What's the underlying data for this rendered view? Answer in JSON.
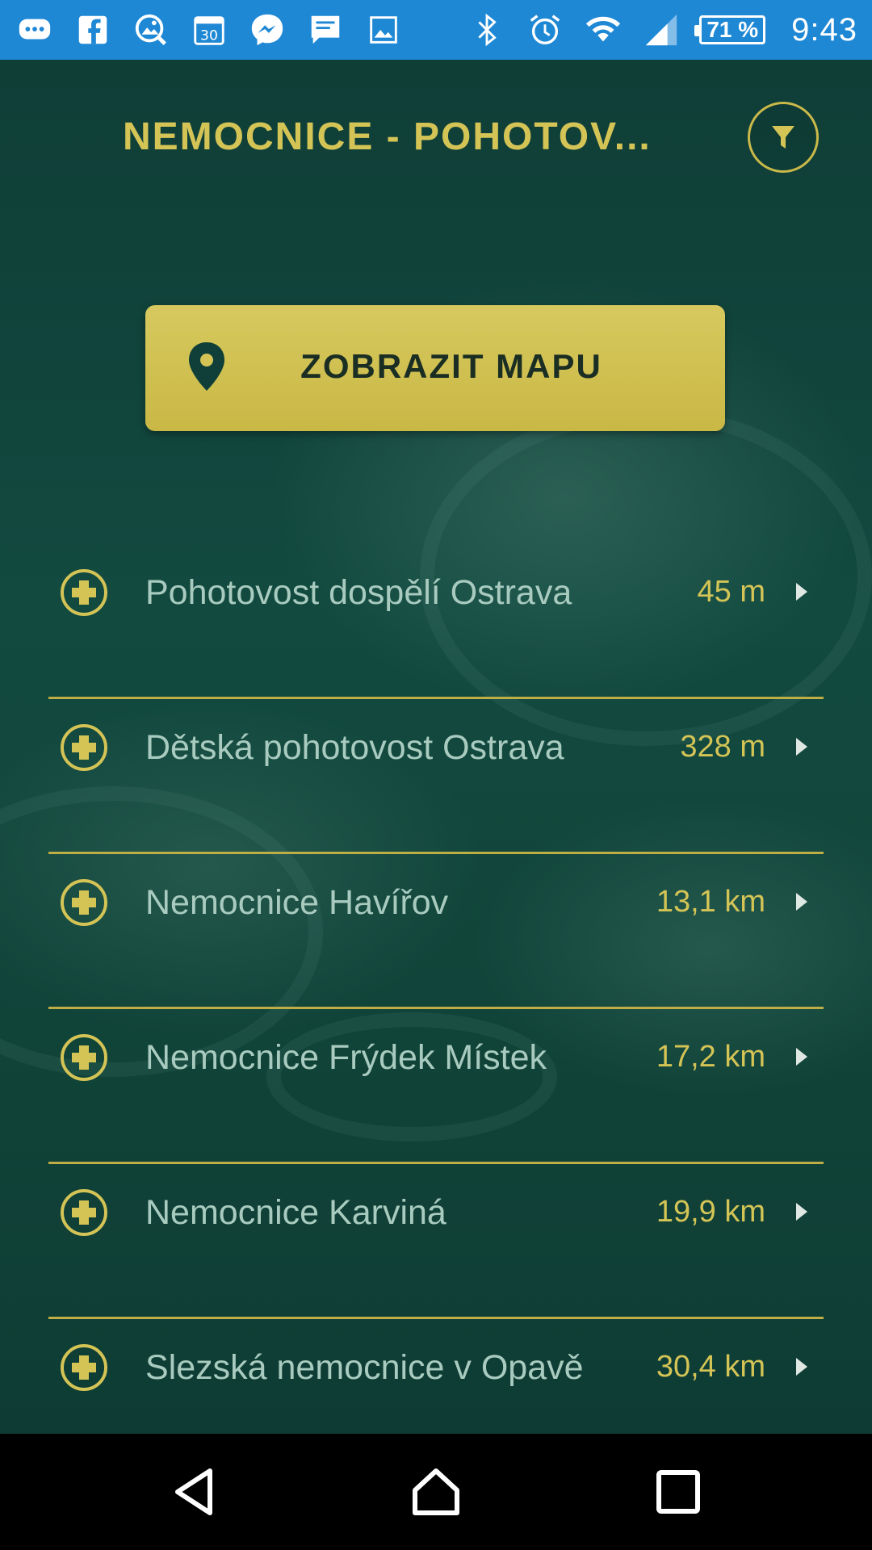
{
  "status_bar": {
    "time": "9:43",
    "battery": "71 %",
    "left_icons": [
      "chat-bubble-icon",
      "facebook-icon",
      "image-search-icon",
      "calendar-icon",
      "messenger-icon",
      "message-icon",
      "gallery-icon"
    ],
    "right_icons": [
      "bluetooth-icon",
      "alarm-icon",
      "wifi-icon",
      "signal-icon"
    ]
  },
  "header": {
    "title": "NEMOCNICE - POHOTOV..."
  },
  "map_button": {
    "label": "ZOBRAZIT MAPU"
  },
  "hospitals": [
    {
      "name": "Pohotovost dospělí Ostrava",
      "distance": "45 m"
    },
    {
      "name": "Dětská pohotovost Ostrava",
      "distance": "328 m"
    },
    {
      "name": "Nemocnice Havířov",
      "distance": "13,1 km"
    },
    {
      "name": "Nemocnice Frýdek Místek",
      "distance": "17,2 km"
    },
    {
      "name": "Nemocnice Karviná",
      "distance": "19,9 km"
    },
    {
      "name": "Slezská nemocnice v Opavě",
      "distance": "30,4 km"
    }
  ],
  "colors": {
    "accent_gold": "#d4c456",
    "background_green": "#0f3f38",
    "list_text": "#a9cbbf",
    "status_bar_blue": "#1e88d5"
  },
  "nav": {
    "icons": [
      "back-icon",
      "home-icon",
      "recents-icon"
    ]
  }
}
